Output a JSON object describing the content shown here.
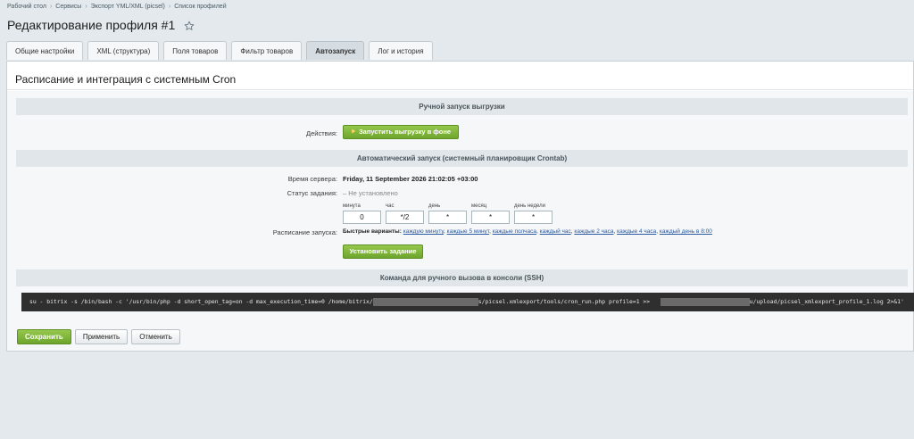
{
  "breadcrumb": [
    "Рабочий стол",
    "Сервисы",
    "Экспорт YML/XML (picsel)",
    "Список профилей"
  ],
  "page_title": "Редактирование профиля #1",
  "tabs": [
    {
      "label": "Общие настройки"
    },
    {
      "label": "XML (структура)"
    },
    {
      "label": "Поля товаров"
    },
    {
      "label": "Фильтр товаров"
    },
    {
      "label": "Автозапуск",
      "active": true
    },
    {
      "label": "Лог и история"
    }
  ],
  "panel_title": "Расписание и интеграция с системным Cron",
  "manual": {
    "section": "Ручной запуск выгрузки",
    "actions_label": "Действия:",
    "run_button": "Запустить выгрузку в фоне"
  },
  "auto": {
    "section": "Автоматический запуск (системный планировщик Crontab)",
    "server_time_label": "Время сервера:",
    "server_time": "Friday, 11 September 2026 21:02:05 +03:00",
    "status_label": "Статус задания:",
    "status": "– Не установлено",
    "fields": [
      {
        "label": "минута",
        "value": "0"
      },
      {
        "label": "час",
        "value": "*/2"
      },
      {
        "label": "день",
        "value": "*"
      },
      {
        "label": "месяц",
        "value": "*"
      },
      {
        "label": "день недели",
        "value": "*"
      }
    ],
    "schedule_label": "Расписание запуска:",
    "quick_title": "Быстрые варианты:",
    "quick_options": [
      "каждую минуту",
      "каждые 5 минут",
      "каждые полчаса",
      "каждый час",
      "каждые 2 часа",
      "каждые 4 часа",
      "каждый день в 8:00"
    ],
    "set_button": "Установить задание"
  },
  "ssh": {
    "section": "Команда для ручного вызова в консоли (SSH)",
    "cmd_part1": "su - bitrix -s /bin/bash -c '/usr/bin/php -d short_open_tag=on -d max_execution_time=0 /home/bitrix/",
    "cmd_part2": "s/picsel.xmlexport/tools/cron_run.php profile=1 >>",
    "cmd_part3": "u/upload/picsel_xmlexport_profile_1.log 2>&1'"
  },
  "footer": {
    "save": "Сохранить",
    "apply": "Применить",
    "cancel": "Отменить"
  },
  "colors": {
    "accent_green": "#7ab33a",
    "link": "#2c5aa0",
    "console_bg": "#2f2f2f"
  }
}
